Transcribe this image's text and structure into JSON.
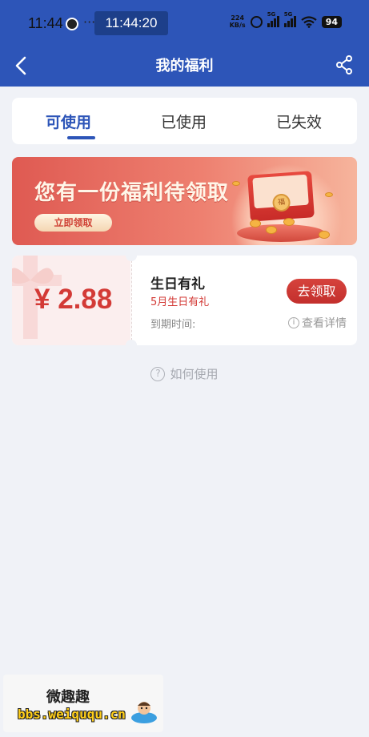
{
  "status_bar": {
    "time": "11:44",
    "dots": "···",
    "clock": "11:44:20",
    "net_speed_value": "224",
    "net_speed_unit": "KB/s",
    "signal1_label": "5G",
    "signal2_label": "5G",
    "battery": "94"
  },
  "header": {
    "title": "我的福利"
  },
  "tabs": [
    {
      "label": "可使用",
      "active": true
    },
    {
      "label": "已使用",
      "active": false
    },
    {
      "label": "已失效",
      "active": false
    }
  ],
  "banner": {
    "title": "您有一份福利待领取",
    "button": "立即领取",
    "seal_text": "福"
  },
  "coupon": {
    "price": "¥ 2.88",
    "name": "生日有礼",
    "subtitle": "5月生日有礼",
    "expiry_label": "到期时间:",
    "claim_button": "去领取",
    "details_link": "查看详情"
  },
  "help": {
    "label": "如何使用"
  },
  "watermark": {
    "title": "微趣趣",
    "url": "bbs.weiququ.cn"
  },
  "colors": {
    "header_blue": "#2d55b8",
    "accent_red": "#d33a36",
    "page_bg": "#f0f2f7"
  }
}
